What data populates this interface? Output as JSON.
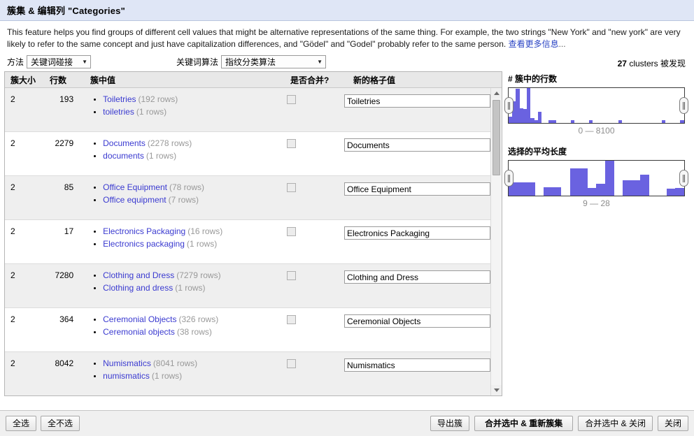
{
  "window": {
    "title": "簇集 & 编辑列 \"Categories\""
  },
  "description": {
    "text": "This feature helps you find groups of different cell values that might be alternative representations of the same thing. For example, the two strings \"New York\" and \"new york\" are very likely to refer to the same concept and just have capitalization differences, and \"Gödel\" and \"Godel\" probably refer to the same person.",
    "link_label": "查看更多信息",
    "link_suffix": "..."
  },
  "controls": {
    "method_label": "方法",
    "method_value": "关键词碰接",
    "keying_label": "关键词算法",
    "keying_value": "指纹分类算法",
    "cluster_count_number": "27",
    "cluster_count_suffix": "clusters 被发现"
  },
  "table": {
    "headers": {
      "size": "簇大小",
      "rows": "行数",
      "values": "簇中值",
      "merge": "是否合并?",
      "new_value": "新的格子值"
    },
    "rows_count_label": "rows",
    "rows": [
      {
        "size": "2",
        "rows": "193",
        "values": [
          {
            "text": "Toiletries",
            "count": "(192 rows)"
          },
          {
            "text": "toiletries",
            "count": "(1 rows)"
          }
        ],
        "merge_checked": false,
        "new_value": "Toiletries"
      },
      {
        "size": "2",
        "rows": "2279",
        "values": [
          {
            "text": "Documents",
            "count": "(2278 rows)"
          },
          {
            "text": "documents",
            "count": "(1 rows)"
          }
        ],
        "merge_checked": false,
        "new_value": "Documents"
      },
      {
        "size": "2",
        "rows": "85",
        "values": [
          {
            "text": "Office Equipment",
            "count": "(78 rows)"
          },
          {
            "text": "Office equipment",
            "count": "(7 rows)"
          }
        ],
        "merge_checked": false,
        "new_value": "Office Equipment"
      },
      {
        "size": "2",
        "rows": "17",
        "values": [
          {
            "text": "Electronics Packaging",
            "count": "(16 rows)"
          },
          {
            "text": "Electronics packaging",
            "count": "(1 rows)"
          }
        ],
        "merge_checked": false,
        "new_value": "Electronics Packaging"
      },
      {
        "size": "2",
        "rows": "7280",
        "values": [
          {
            "text": "Clothing and Dress",
            "count": "(7279 rows)"
          },
          {
            "text": "Clothing and dress",
            "count": "(1 rows)"
          }
        ],
        "merge_checked": false,
        "new_value": "Clothing and Dress"
      },
      {
        "size": "2",
        "rows": "364",
        "values": [
          {
            "text": "Ceremonial Objects",
            "count": "(326 rows)"
          },
          {
            "text": "Ceremonial objects",
            "count": "(38 rows)"
          }
        ],
        "merge_checked": false,
        "new_value": "Ceremonial Objects"
      },
      {
        "size": "2",
        "rows": "8042",
        "values": [
          {
            "text": "Numismatics",
            "count": "(8041 rows)"
          },
          {
            "text": "numismatics",
            "count": "(1 rows)"
          }
        ],
        "merge_checked": false,
        "new_value": "Numismatics"
      }
    ]
  },
  "facets": [
    {
      "title": "# 簇中的行数",
      "range_label": "0 — 8100",
      "bar_color": "#6a62e0",
      "chart_data": {
        "type": "bar",
        "title": "# 簇中的行数",
        "xlabel": "",
        "ylabel": "",
        "xlim": [
          0,
          8100
        ],
        "grid": false,
        "categories": [
          "0",
          "170",
          "340",
          "510",
          "680",
          "850",
          "1020",
          "1190",
          "1360",
          "1530",
          "1700",
          "1870",
          "2040",
          "2210",
          "2380",
          "2550",
          "2720",
          "2890",
          "3060",
          "3230",
          "3400",
          "3570",
          "3740",
          "3910",
          "4080",
          "4250",
          "4420",
          "4590",
          "4760",
          "4930",
          "5100",
          "5270",
          "5440",
          "5610",
          "5780",
          "5950",
          "6120",
          "6290",
          "6460",
          "6630",
          "6800",
          "6970",
          "7140",
          "7310",
          "7480",
          "7650",
          "7820",
          "7990"
        ],
        "values": [
          18,
          62,
          98,
          42,
          40,
          100,
          14,
          8,
          32,
          0,
          0,
          9,
          9,
          0,
          0,
          0,
          0,
          9,
          0,
          0,
          0,
          0,
          9,
          0,
          0,
          0,
          0,
          0,
          0,
          0,
          9,
          0,
          0,
          0,
          0,
          0,
          0,
          0,
          0,
          0,
          0,
          0,
          9,
          0,
          0,
          0,
          0,
          9
        ]
      }
    },
    {
      "title": "选择的平均长度",
      "range_label": "9 — 28",
      "bar_color": "#6a62e0",
      "chart_data": {
        "type": "bar",
        "title": "选择的平均长度",
        "xlabel": "",
        "ylabel": "",
        "xlim": [
          9,
          28
        ],
        "grid": false,
        "categories": [
          "9",
          "10",
          "11",
          "12",
          "13",
          "14",
          "15",
          "16",
          "17",
          "18",
          "19",
          "20",
          "21",
          "22",
          "23",
          "24",
          "25",
          "26",
          "27",
          "28"
        ],
        "values": [
          38,
          38,
          38,
          0,
          25,
          25,
          0,
          78,
          78,
          22,
          35,
          100,
          0,
          45,
          45,
          60,
          0,
          0,
          20,
          22
        ]
      }
    }
  ],
  "footer": {
    "select_all": "全选",
    "deselect_all": "全不选",
    "export_clusters": "导出簇",
    "merge_and_recluster": "合并选中 & 重新簇集",
    "merge_and_close": "合并选中 & 关闭",
    "close": "关闭"
  },
  "icons": {
    "scroll_up": "triangle-up-icon",
    "scroll_down": "triangle-down-icon",
    "dropdown_arrow": "chevron-down-icon"
  }
}
